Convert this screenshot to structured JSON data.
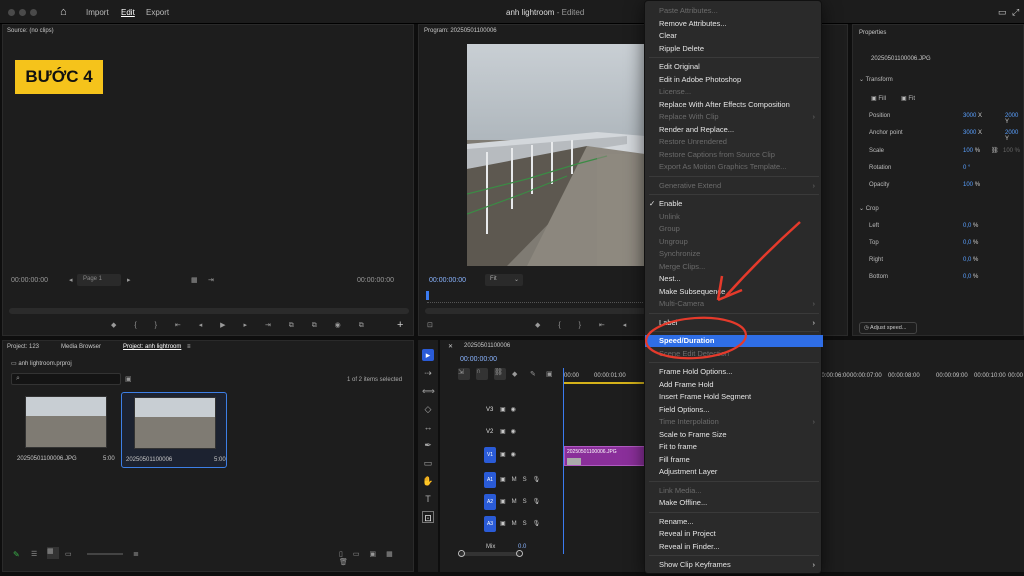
{
  "topbar": {
    "nav": [
      "Import",
      "Edit",
      "Export"
    ],
    "title": "anh lightroom",
    "status": "- Edited"
  },
  "source": {
    "title": "Source: (no clips)",
    "timecode_left": "00:00:00:00",
    "page": "Page 1",
    "timecode_right": "00:00:00:00"
  },
  "badge": {
    "text": "BƯỚC 4"
  },
  "program": {
    "title": "Program: 20250501100006",
    "timecode": "00:00:00:00",
    "fit": "Fit"
  },
  "project": {
    "tabs": [
      "Project: 123",
      "Media Browser",
      "Project: anh lightroom"
    ],
    "file": "anh lightroom.prproj",
    "count": "1 of 2 items selected",
    "items": [
      {
        "name": "20250501100006.JPG",
        "dur": "5:00"
      },
      {
        "name": "20250501100006",
        "dur": "5:00"
      }
    ]
  },
  "timeline": {
    "title": "20250501100006",
    "timecode": "00:00:00:00",
    "ruler": [
      "00:00",
      "00:00:01:00",
      "00:00:06:00",
      "00:00:07:00",
      "00:00:08:00",
      "00:00:09:00",
      "00:00:10:00",
      "00:00"
    ],
    "tracks": [
      "V3",
      "V2",
      "V1",
      "A1",
      "A2",
      "A3"
    ],
    "clip": "20250501100006.JPG",
    "mix": "Mix",
    "mixval": "0.0"
  },
  "properties": {
    "title": "Properties",
    "file": "20250501100006.JPG",
    "transform": "Transform",
    "fill": "Fill",
    "fit": "Fit",
    "position": {
      "label": "Position",
      "x": "3000",
      "y": "2000"
    },
    "anchor": {
      "label": "Anchor point",
      "x": "3000",
      "y": "2000"
    },
    "scale": {
      "label": "Scale",
      "v1": "100",
      "v2": "100"
    },
    "rotation": {
      "label": "Rotation",
      "v": "0 °"
    },
    "opacity": {
      "label": "Opacity",
      "v": "100"
    },
    "crop": "Crop",
    "left": {
      "label": "Left",
      "v": "0,0"
    },
    "top": {
      "label": "Top",
      "v": "0,0"
    },
    "right": {
      "label": "Right",
      "v": "0,0"
    },
    "bottom": {
      "label": "Bottom",
      "v": "0,0"
    },
    "adjust": "Adjust speed..."
  },
  "menu": {
    "items": [
      {
        "label": "Paste Attributes...",
        "dis": true
      },
      {
        "label": "Remove Attributes...",
        "dis": false
      },
      {
        "label": "Clear",
        "dis": false
      },
      {
        "label": "Ripple Delete",
        "dis": false
      },
      {
        "sep": true
      },
      {
        "label": "Edit Original",
        "dis": false
      },
      {
        "label": "Edit in Adobe Photoshop",
        "dis": false
      },
      {
        "label": "License...",
        "dis": true
      },
      {
        "label": "Replace With After Effects Composition",
        "dis": false
      },
      {
        "label": "Replace With Clip",
        "dis": true,
        "sub": true
      },
      {
        "label": "Render and Replace...",
        "dis": false
      },
      {
        "label": "Restore Unrendered",
        "dis": true
      },
      {
        "label": "Restore Captions from Source Clip",
        "dis": true
      },
      {
        "label": "Export As Motion Graphics Template...",
        "dis": true
      },
      {
        "sep": true
      },
      {
        "label": "Generative Extend",
        "dis": true,
        "sub": true
      },
      {
        "sep": true
      },
      {
        "label": "Enable",
        "dis": false,
        "check": true
      },
      {
        "label": "Unlink",
        "dis": true
      },
      {
        "label": "Group",
        "dis": true
      },
      {
        "label": "Ungroup",
        "dis": true
      },
      {
        "label": "Synchronize",
        "dis": true
      },
      {
        "label": "Merge Clips...",
        "dis": true
      },
      {
        "label": "Nest...",
        "dis": false
      },
      {
        "label": "Make Subsequence",
        "dis": false
      },
      {
        "label": "Multi-Camera",
        "dis": true,
        "sub": true
      },
      {
        "sep": true
      },
      {
        "label": "Label",
        "dis": false,
        "sub": true
      },
      {
        "sep": true
      },
      {
        "label": "Speed/Duration",
        "dis": false,
        "hl": true
      },
      {
        "label": "Scene Edit Detection",
        "dis": true
      },
      {
        "sep": true
      },
      {
        "label": "Frame Hold Options...",
        "dis": false
      },
      {
        "label": "Add Frame Hold",
        "dis": false
      },
      {
        "label": "Insert Frame Hold Segment",
        "dis": false
      },
      {
        "label": "Field Options...",
        "dis": false
      },
      {
        "label": "Time Interpolation",
        "dis": true,
        "sub": true
      },
      {
        "label": "Scale to Frame Size",
        "dis": false
      },
      {
        "label": "Fit to frame",
        "dis": false
      },
      {
        "label": "Fill frame",
        "dis": false
      },
      {
        "label": "Adjustment Layer",
        "dis": false
      },
      {
        "sep": true
      },
      {
        "label": "Link Media...",
        "dis": true
      },
      {
        "label": "Make Offline...",
        "dis": false
      },
      {
        "sep": true
      },
      {
        "label": "Rename...",
        "dis": false
      },
      {
        "label": "Reveal in Project",
        "dis": false
      },
      {
        "label": "Reveal in Finder...",
        "dis": false
      },
      {
        "sep": true
      },
      {
        "label": "Show Clip Keyframes",
        "dis": false,
        "sub": true
      }
    ]
  },
  "colors": {
    "accent": "#2f6ee6",
    "badge": "#f5c31b",
    "clip": "#8a2f9a",
    "annotation": "#e53a2b"
  }
}
